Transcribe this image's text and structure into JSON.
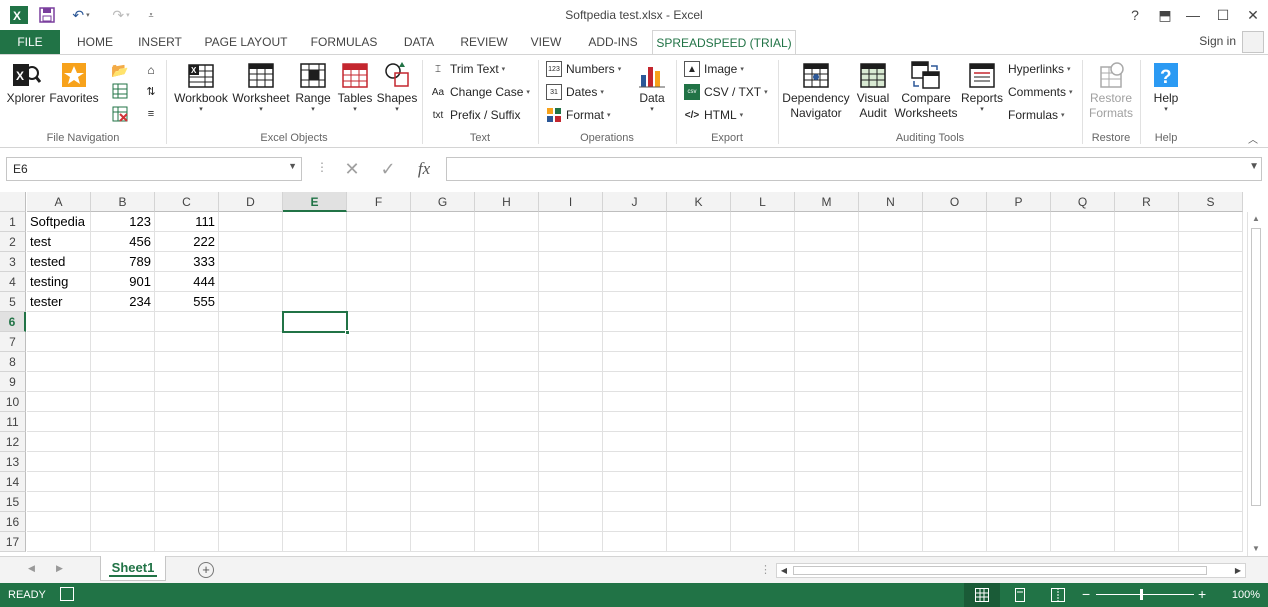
{
  "window": {
    "title": "Softpedia test.xlsx - Excel",
    "help": "?",
    "controls": [
      "⬒",
      "—",
      "☐",
      "✕"
    ]
  },
  "quick_access": {
    "save_icon": "save-icon",
    "undo_icon": "undo-icon",
    "redo_icon": "redo-icon"
  },
  "tabs": [
    {
      "label": "FILE"
    },
    {
      "label": "HOME"
    },
    {
      "label": "INSERT"
    },
    {
      "label": "PAGE LAYOUT"
    },
    {
      "label": "FORMULAS"
    },
    {
      "label": "DATA"
    },
    {
      "label": "REVIEW"
    },
    {
      "label": "VIEW"
    },
    {
      "label": "ADD-INS"
    },
    {
      "label": "SPREADSPEED (TRIAL)"
    }
  ],
  "signin": "Sign in",
  "ribbon": {
    "file_navigation": {
      "xplorer": "Xplorer",
      "favorites": "Favorites",
      "group": "File Navigation"
    },
    "excel_objects": {
      "workbook": "Workbook",
      "worksheet": "Worksheet",
      "range": "Range",
      "tables": "Tables",
      "shapes": "Shapes",
      "group": "Excel Objects"
    },
    "text": {
      "trim_text": "Trim Text",
      "change_case": "Change Case",
      "prefix_suffix": "Prefix / Suffix",
      "group": "Text"
    },
    "operations": {
      "numbers": "Numbers",
      "dates": "Dates",
      "format": "Format",
      "data": "Data",
      "group": "Operations"
    },
    "export": {
      "image": "Image",
      "csv_txt": "CSV / TXT",
      "html": "HTML",
      "group": "Export"
    },
    "auditing": {
      "dependency": "Dependency",
      "navigator": "Navigator",
      "visual": "Visual",
      "audit": "Audit",
      "compare": "Compare",
      "worksheets": "Worksheets",
      "reports": "Reports",
      "hyperlinks": "Hyperlinks",
      "comments": "Comments",
      "formulas": "Formulas",
      "group": "Auditing Tools"
    },
    "restore": {
      "restore": "Restore",
      "formats": "Formats",
      "group": "Restore"
    },
    "help": {
      "help": "Help",
      "group": "Help"
    }
  },
  "formula_bar": {
    "name_box": "E6",
    "formula": "",
    "fx": "fx"
  },
  "grid": {
    "columns": [
      "A",
      "B",
      "C",
      "D",
      "E",
      "F",
      "G",
      "H",
      "I",
      "J",
      "K",
      "L",
      "M",
      "N",
      "O",
      "P",
      "Q",
      "R",
      "S"
    ],
    "rows": [
      "1",
      "2",
      "3",
      "4",
      "5",
      "6",
      "7",
      "8",
      "9",
      "10",
      "11",
      "12",
      "13",
      "14",
      "15",
      "16",
      "17"
    ],
    "selected_column": "E",
    "selected_row": "6",
    "data": [
      [
        "Softpedia",
        "123",
        "111"
      ],
      [
        "test",
        "456",
        "222"
      ],
      [
        "tested",
        "789",
        "333"
      ],
      [
        "testing",
        "901",
        "444"
      ],
      [
        "tester",
        "234",
        "555"
      ]
    ]
  },
  "sheets": [
    "Sheet1"
  ],
  "status": {
    "ready": "READY",
    "zoom": "100%"
  },
  "colors": {
    "accent": "#217346"
  }
}
